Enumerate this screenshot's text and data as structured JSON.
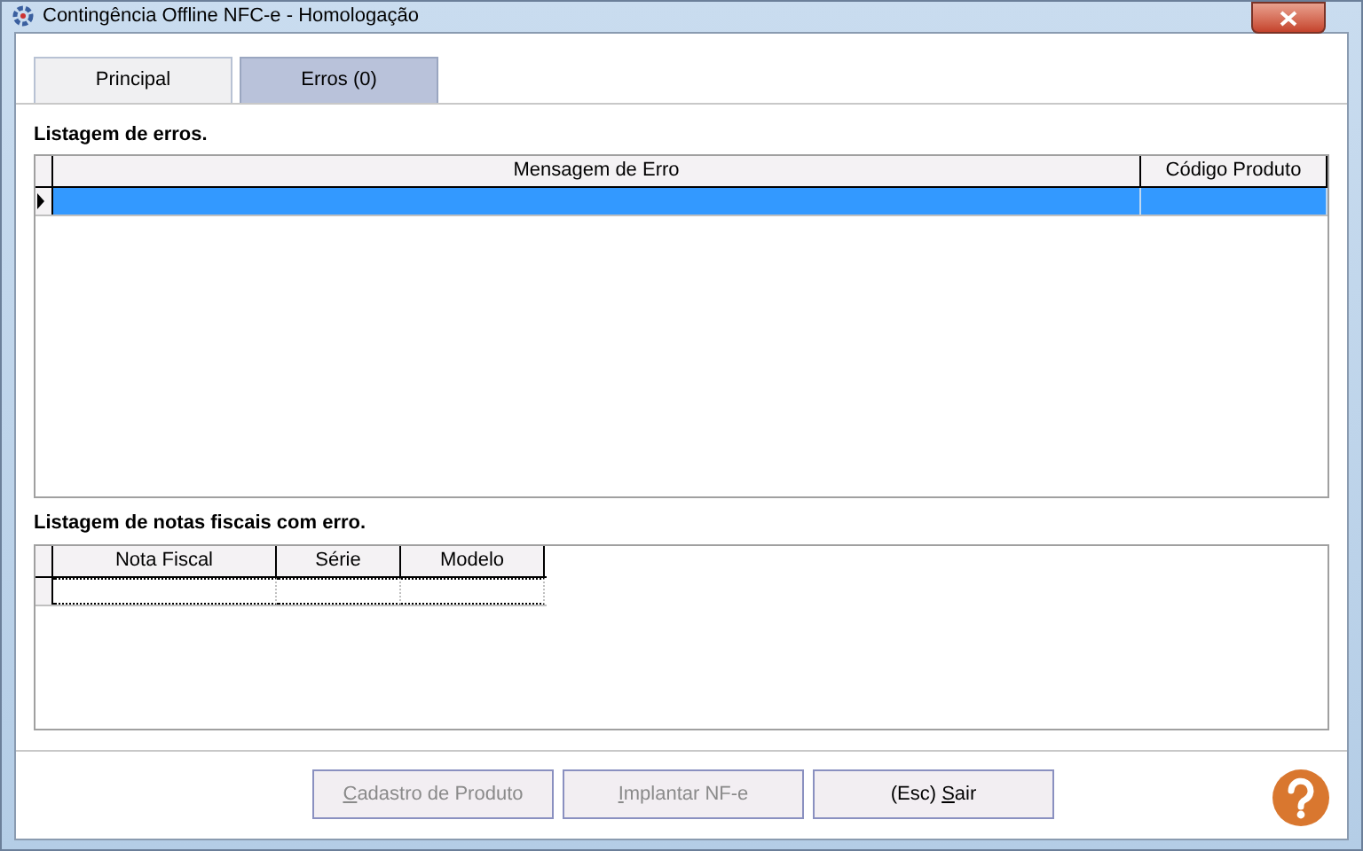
{
  "window": {
    "title": "Contingência Offline NFC-e - Homologação"
  },
  "tabs": [
    {
      "label": "Principal",
      "selected": false
    },
    {
      "label": "Erros (0)",
      "selected": true
    }
  ],
  "errors": {
    "label": "Listagem de erros.",
    "columns": [
      "Mensagem de Erro",
      "Código Produto"
    ],
    "rows": [
      {
        "selected": true
      }
    ]
  },
  "invoices": {
    "label": "Listagem de notas fiscais com erro.",
    "columns": [
      "Nota Fiscal",
      "Série",
      "Modelo"
    ],
    "rows": [
      {
        "selected": false
      }
    ]
  },
  "buttons": [
    {
      "parts": [
        {
          "text": "C",
          "underline": true
        },
        {
          "text": "adastro de Produto",
          "underline": false
        }
      ],
      "disabled": true
    },
    {
      "parts": [
        {
          "text": "I",
          "underline": true
        },
        {
          "text": "mplantar NF-e",
          "underline": false
        }
      ],
      "disabled": true
    },
    {
      "parts": [
        {
          "text": "(Esc) ",
          "underline": false
        },
        {
          "text": "S",
          "underline": true
        },
        {
          "text": "air",
          "underline": false
        }
      ],
      "disabled": false
    }
  ]
}
